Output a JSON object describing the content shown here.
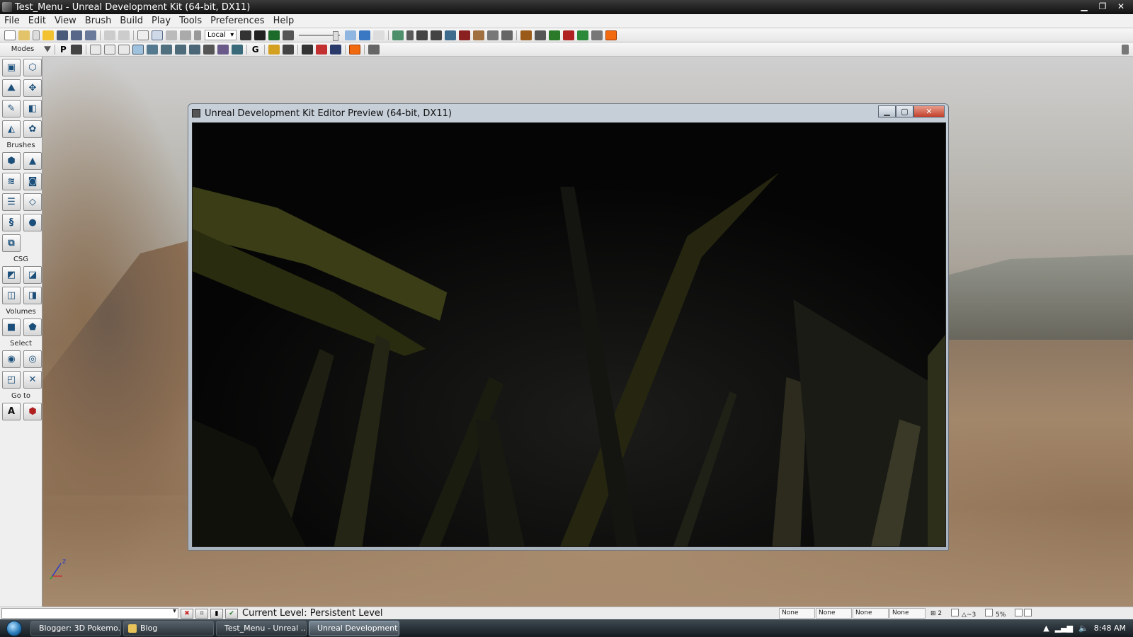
{
  "window": {
    "title": "Test_Menu - Unreal Development Kit (64-bit, DX11)"
  },
  "menu": [
    "File",
    "Edit",
    "View",
    "Brush",
    "Build",
    "Play",
    "Tools",
    "Preferences",
    "Help"
  ],
  "toolbar": {
    "coord_system": "Local"
  },
  "modes_panel": {
    "modes_label": "Modes",
    "brushes_label": "Brushes",
    "csg_label": "CSG",
    "volumes_label": "Volumes",
    "select_label": "Select",
    "goto_label": "Go to",
    "toolbar2_p": "P",
    "toolbar2_g": "G",
    "goto_a": "A"
  },
  "viewport": {
    "axis_label": "z"
  },
  "preview": {
    "title": "Unreal Development Kit Editor Preview (64-bit, DX11)"
  },
  "status": {
    "current_level": "Current Level:  Persistent Level",
    "fields": [
      "None",
      "None",
      "None",
      "None"
    ],
    "grid_value": "2",
    "rot_value": "~3",
    "scale_value": "5%"
  },
  "taskbar": {
    "items": [
      "Blogger: 3D Pokemo...",
      "Blog",
      "Test_Menu - Unreal ...",
      "Unreal Development ..."
    ],
    "time": "8:48 AM"
  },
  "colors": {
    "taskbar": "#1f272d",
    "menu_bg": "#f1f1f1",
    "preview_frame": "#b9c3ce",
    "close_red": "#c2402a"
  }
}
